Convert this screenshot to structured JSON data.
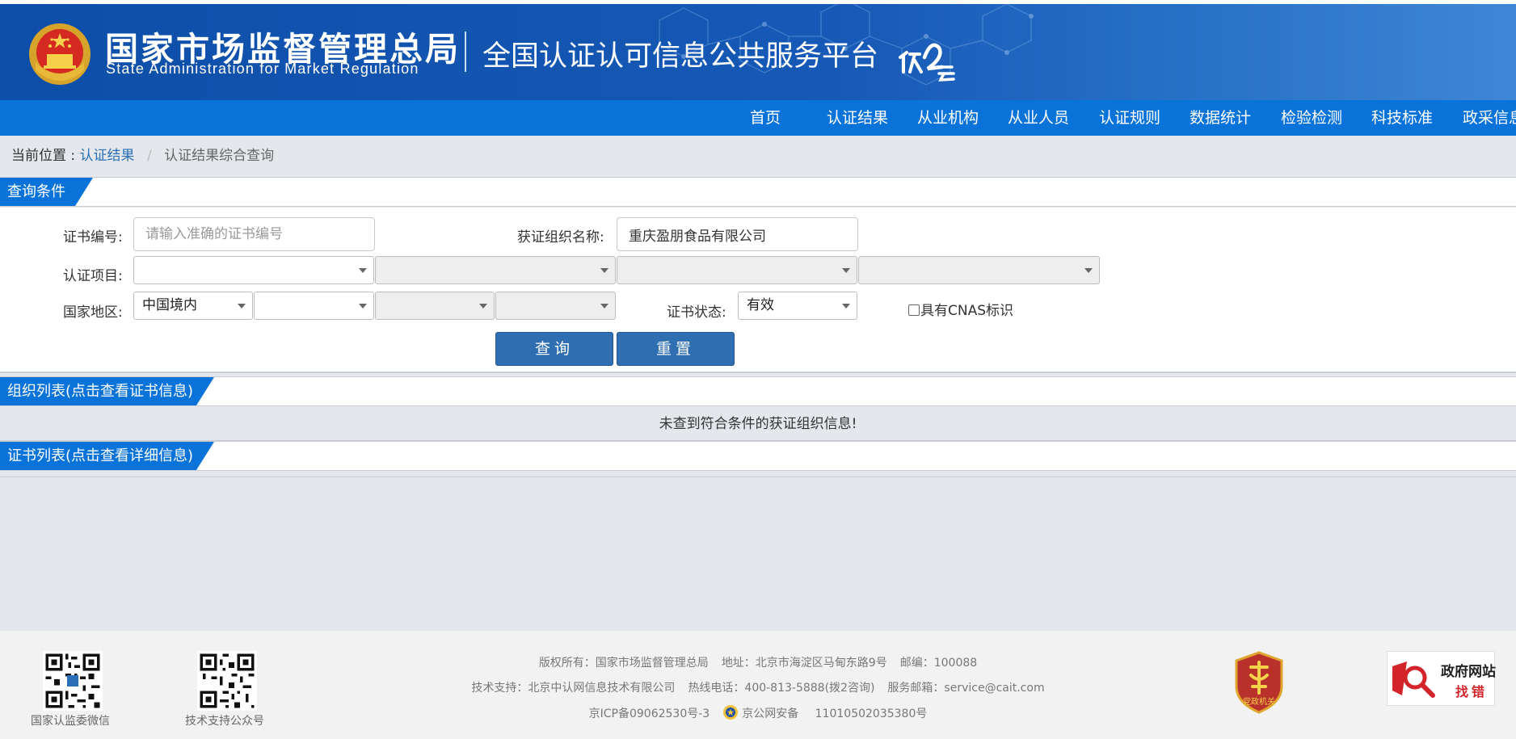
{
  "header": {
    "agency_cn": "国家市场监督管理总局",
    "agency_en": "State Administration  for  Market Regulation",
    "platform_title": "全国认证认可信息公共服务平台"
  },
  "nav": {
    "items": [
      "首页",
      "认证结果",
      "从业机构",
      "从业人员",
      "认证规则",
      "数据统计",
      "检验检测",
      "科技标准",
      "政采信息"
    ]
  },
  "breadcrumb": {
    "label": "当前位置 :",
    "link": "认证结果",
    "separator": "/",
    "current": "认证结果综合查询"
  },
  "query": {
    "section_title": "查询条件",
    "cert_no_label": "证书编号:",
    "cert_no_placeholder": "请输入准确的证书编号",
    "cert_no_value": "",
    "org_name_label": "获证组织名称:",
    "org_name_value": "重庆盈朋食品有限公司",
    "project_label": "认证项目:",
    "region_label": "国家地区:",
    "region_value": "中国境内",
    "status_label": "证书状态:",
    "status_value": "有效",
    "cnas_label": "具有CNAS标识",
    "cnas_checked": false,
    "search_button": "查询",
    "reset_button": "重置"
  },
  "org_list": {
    "section_title": "组织列表(点击查看证书信息)",
    "empty_message": "未查到符合条件的获证组织信息!"
  },
  "cert_list": {
    "section_title": "证书列表(点击查看详细信息)"
  },
  "footer": {
    "qr1_label": "国家认监委微信",
    "qr2_label": "技术支持公众号",
    "copyright": "版权所有：国家市场监督管理总局",
    "address": "地址：北京市海淀区马甸东路9号",
    "postcode": "邮编：100088",
    "tech_support": "技术支持：北京中认网信息技术有限公司",
    "hotline": "热线电话：400-813-5888(拨2咨询)",
    "email": "服务邮箱：service@cait.com",
    "icp": "京ICP备09062530号-3",
    "police": "京公网安备",
    "police_no": "11010502035380号",
    "badge_party": "党政机关",
    "badge_gov_title": "政府网站",
    "badge_gov_sub": "找错"
  },
  "colors": {
    "header_blue": "#1659b6",
    "nav_blue": "#0a73d9",
    "button_blue": "#2f6fb1",
    "link_blue": "#2a6fb8"
  }
}
